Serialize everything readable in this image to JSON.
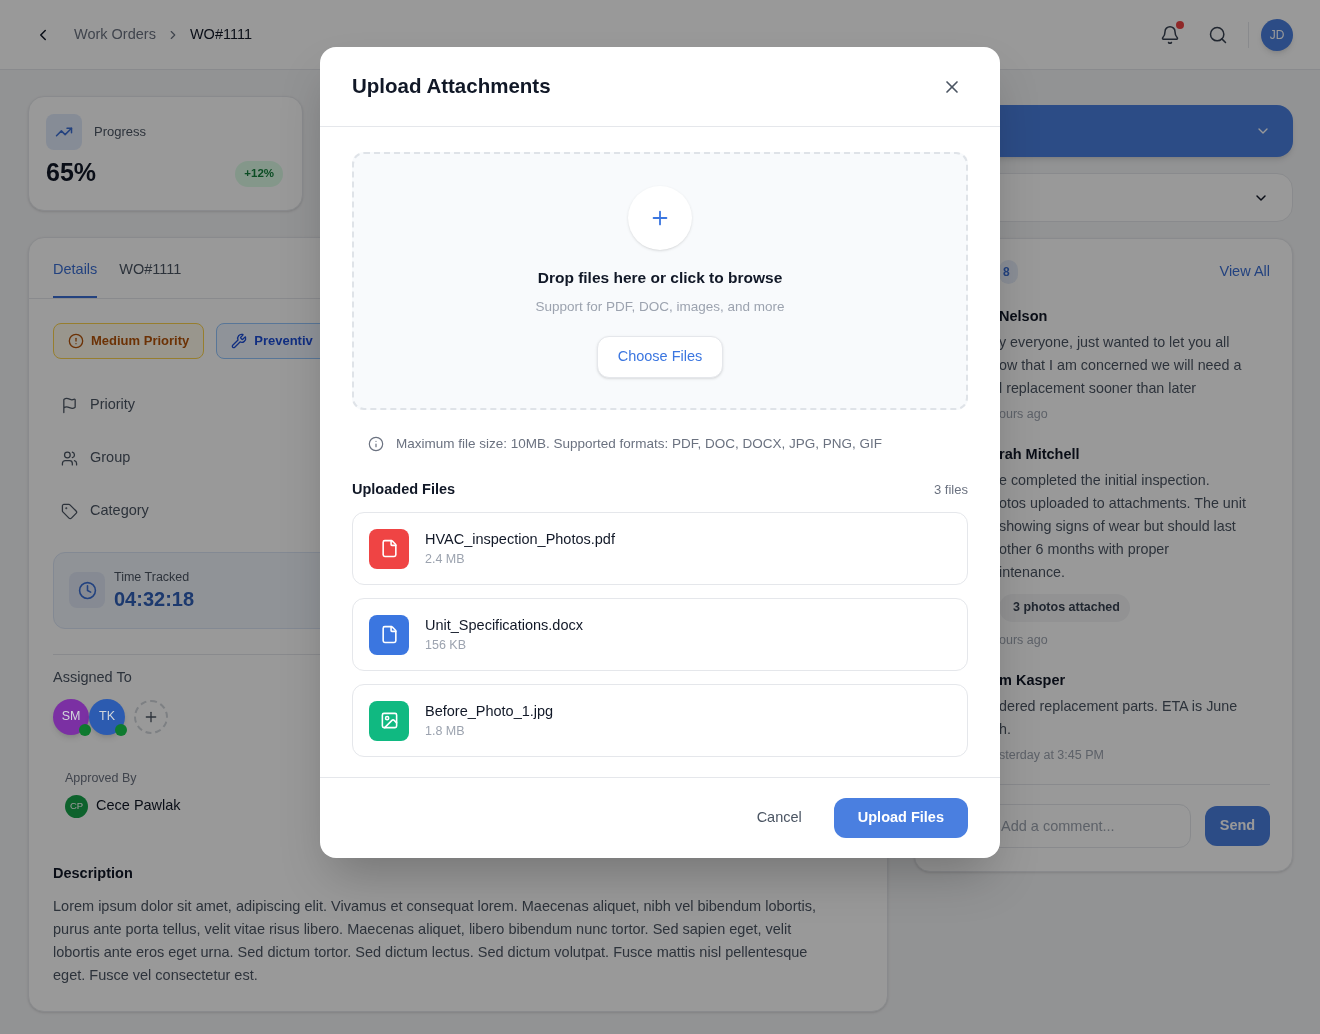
{
  "header": {
    "breadcrumbs": [
      {
        "label": "Work Orders",
        "current": false
      },
      {
        "label": "WO#1111",
        "current": true
      }
    ],
    "notifications_unread": true,
    "user_initials": "JD"
  },
  "progress_card": {
    "label": "Progress",
    "value": "65%",
    "change": "+12%"
  },
  "details_card": {
    "tabs": [
      {
        "label": "Details",
        "selected": true
      },
      {
        "label": "WO#1111",
        "selected": false
      }
    ],
    "badges": [
      {
        "kind": "priority",
        "label": "Medium Priority"
      },
      {
        "kind": "type",
        "label": "Preventiv"
      }
    ],
    "fields": [
      {
        "kind": "priority",
        "label": "Priority"
      },
      {
        "kind": "group",
        "label": "Group"
      },
      {
        "kind": "category",
        "label": "Category"
      }
    ],
    "time_tracked": {
      "label": "Time Tracked",
      "value": "04:32:18"
    },
    "assigned_to": {
      "label": "Assigned To",
      "people": [
        {
          "initials": "SM",
          "online": true,
          "color": "#7b30a3"
        },
        {
          "initials": "TK",
          "online": true,
          "color": "#2c5bb0"
        }
      ]
    },
    "approved_by": {
      "label": "Approved By",
      "initials": "CP",
      "name": "Cece Pawlak"
    },
    "description": {
      "title": "Description",
      "text": "Lorem ipsum dolor sit amet, adipiscing elit. Vivamus et consequat lorem. Maecenas aliquet, nibh vel bibendum lobortis, purus ante porta tellus, velit vitae risus libero. Maecenas aliquet, libero bibendum nunc tortor. Sed sapien eget, velit lobortis ante eros eget urna. Sed dictum tortor. Sed dictum lectus. Sed dictum volutpat. Fusce mattis nisl pellentesque eget. Fusce vel consectetur est."
    }
  },
  "comments_panel": {
    "count": "8",
    "view_all": "View All",
    "comments": [
      {
        "author": "Nelson",
        "lines": [
          "y everyone, just wanted to let you all",
          "ow that I am concerned we will need a",
          "l replacement sooner than later"
        ],
        "time": "ours ago"
      },
      {
        "author": "rah Mitchell",
        "lines": [
          "e completed the initial inspection.",
          "otos uploaded to attachments. The unit",
          "showing signs of wear but should last",
          "other 6 months with proper",
          "intenance."
        ],
        "attachment": "3 photos attached",
        "time": "ours ago"
      },
      {
        "author": "m Kasper",
        "lines": [
          "dered replacement parts. ETA is June",
          "h."
        ],
        "time": "sterday at 3:45 PM"
      }
    ],
    "input": {
      "placeholder": "Add a comment..."
    },
    "send": "Send"
  },
  "upload_modal": {
    "title": "Upload Attachments",
    "dropzone": {
      "title": "Drop files here or click to browse",
      "subtitle": "Support for PDF, DOC, images, and more",
      "button": "Choose Files"
    },
    "info": "Maximum file size: 10MB. Supported formats: PDF, DOC, DOCX, JPG, PNG, GIF",
    "uploaded": {
      "title": "Uploaded Files",
      "count": "3 files",
      "files": [
        {
          "kind": "pdf",
          "name": "HVAC_inspection_Photos.pdf",
          "size": "2.4 MB"
        },
        {
          "kind": "doc",
          "name": "Unit_Specifications.docx",
          "size": "156 KB"
        },
        {
          "kind": "image",
          "name": "Before_Photo_1.jpg",
          "size": "1.8 MB"
        }
      ]
    },
    "actions": {
      "cancel": "Cancel",
      "submit": "Upload Files"
    }
  }
}
